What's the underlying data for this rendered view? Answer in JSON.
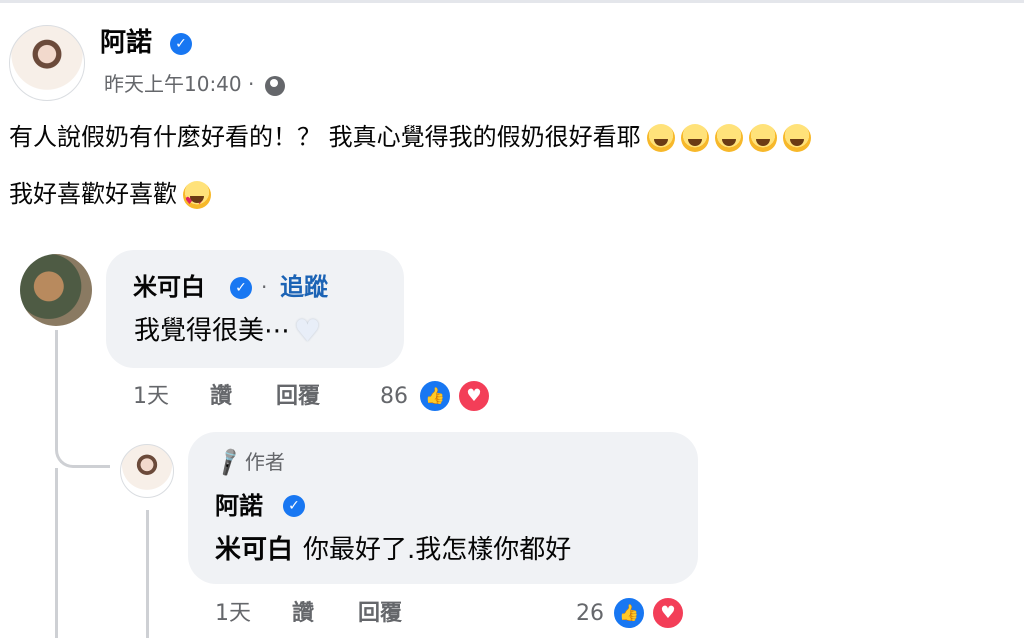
{
  "post": {
    "author": "阿諾",
    "timestamp": "昨天上午10:40",
    "separator": "·",
    "privacy_icon": "globe-icon",
    "text_line1": "有人說假奶有什麼好看的！？ 我真心覺得我的假奶很好看耶",
    "text_line2": "我好喜歡好喜歡",
    "emojis_line1": [
      "grinning-face",
      "winking-face",
      "grinning-face",
      "rofl-face",
      "rofl-face"
    ],
    "emojis_line2": [
      "heart-eyes-face"
    ]
  },
  "comment": {
    "author": "米可白",
    "separator": "·",
    "follow_label": "追蹤",
    "text": "我覺得很美⋯",
    "trailing_icon": "white-heart-icon",
    "time": "1天",
    "like_label": "讚",
    "reply_label": "回覆",
    "reaction_count": "86",
    "reactions": [
      "like-icon",
      "love-icon"
    ]
  },
  "reply": {
    "badge": "作者",
    "author": "阿諾",
    "mention": "米可白",
    "text": "你最好了.我怎樣你都好",
    "time": "1天",
    "like_label": "讚",
    "reply_label": "回覆",
    "reaction_count": "26",
    "reactions": [
      "like-icon",
      "love-icon"
    ]
  },
  "colors": {
    "verified": "#1877f2",
    "follow_link": "#1b63b5",
    "bubble": "#f0f2f5",
    "meta_text": "#65676b",
    "love": "#f33e58"
  }
}
